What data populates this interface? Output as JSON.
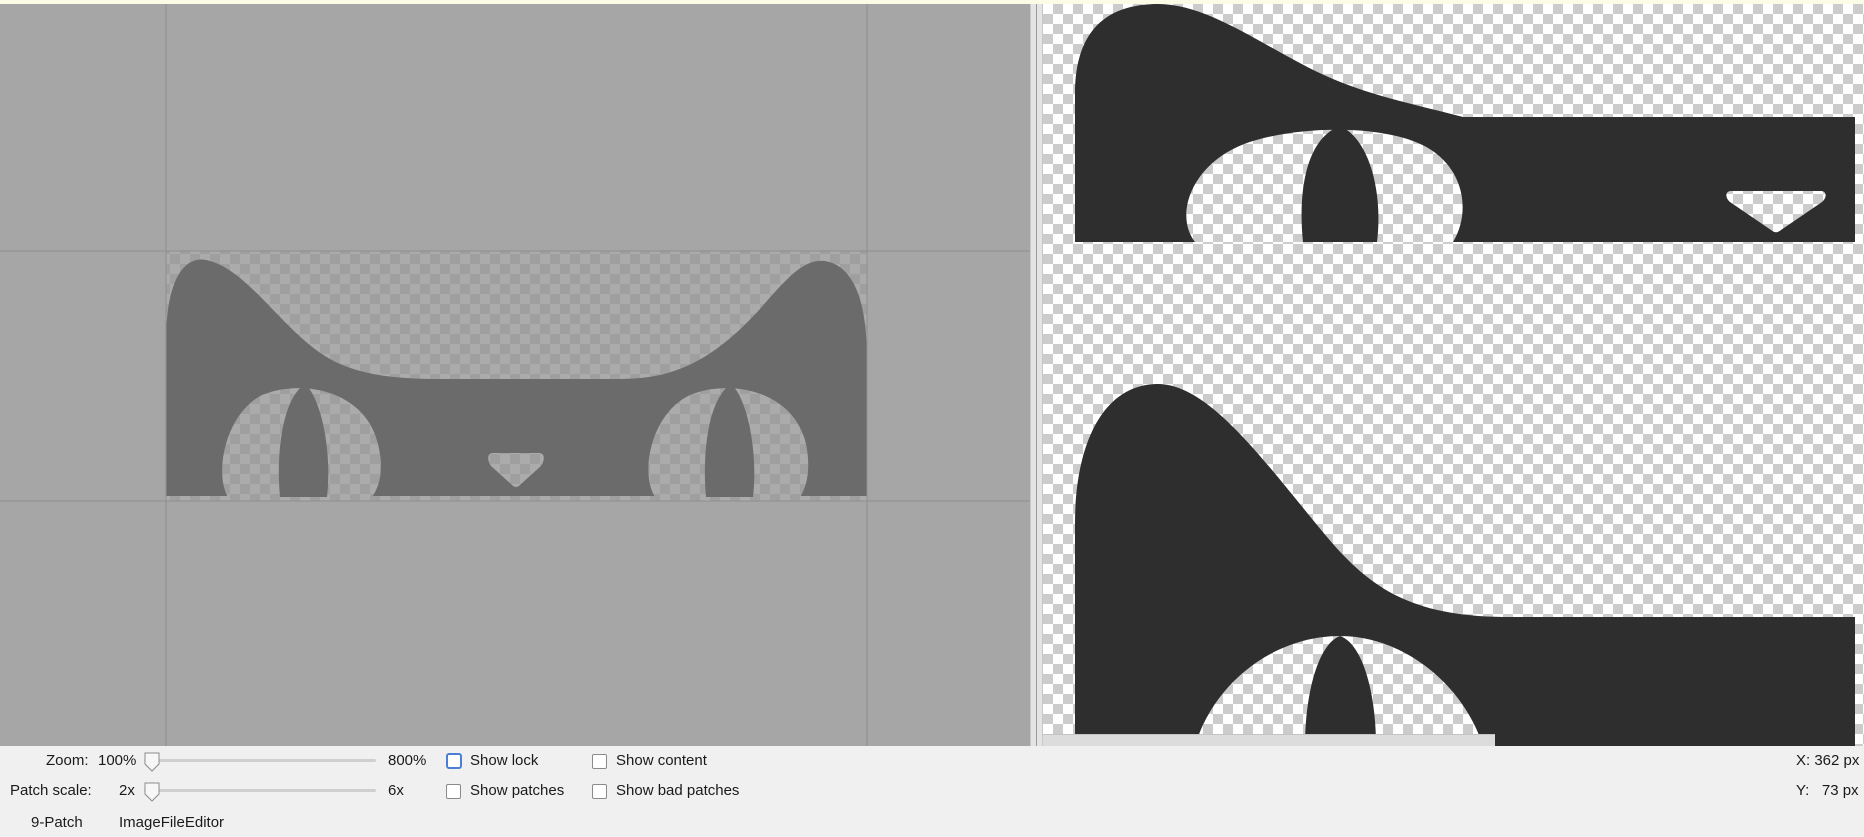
{
  "controls": {
    "zoom_label": "Zoom:",
    "zoom_min": "100%",
    "zoom_max": "800%",
    "patch_scale_label": "Patch scale:",
    "patch_min": "2x",
    "patch_max": "6x",
    "checkboxes": {
      "show_lock": {
        "label": "Show lock",
        "checked": false
      },
      "show_content": {
        "label": "Show content",
        "checked": false
      },
      "show_patches": {
        "label": "Show patches",
        "checked": false
      },
      "show_bad_patches": {
        "label": "Show bad patches",
        "checked": false
      }
    }
  },
  "status": {
    "x": "X: 362 px",
    "y": "Y:   73 px"
  },
  "tabs": [
    "9-Patch",
    "ImageFileEditor"
  ],
  "colors": {
    "editor_bg": "#a6a6a6",
    "shape_dim": "#6b6b6b",
    "shape_dark": "#2e2e2e",
    "checker": "#cccccc",
    "focus": "#4a7fd4"
  }
}
